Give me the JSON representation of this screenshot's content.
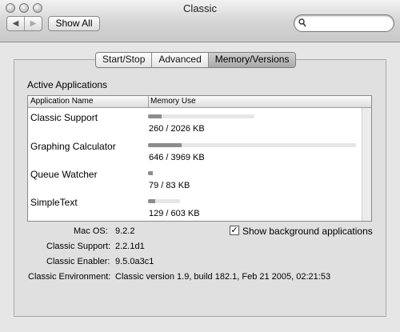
{
  "window": {
    "title": "Classic"
  },
  "toolbar": {
    "back_glyph": "◀",
    "forward_glyph": "▶",
    "show_all_label": "Show All",
    "search_value": ""
  },
  "tabs": [
    {
      "label": "Start/Stop",
      "selected": false
    },
    {
      "label": "Advanced",
      "selected": false
    },
    {
      "label": "Memory/Versions",
      "selected": true
    }
  ],
  "section": {
    "title": "Active Applications"
  },
  "table": {
    "columns": [
      "Application Name",
      "Memory Use"
    ],
    "rows": [
      {
        "name": "Classic Support",
        "memory_text": "260 / 2026 KB",
        "used_kb": 260,
        "total_kb": 2026
      },
      {
        "name": "Graphing Calculator",
        "memory_text": "646 / 3969 KB",
        "used_kb": 646,
        "total_kb": 3969
      },
      {
        "name": "Queue Watcher",
        "memory_text": "79 / 83 KB",
        "used_kb": 79,
        "total_kb": 83
      },
      {
        "name": "SimpleText",
        "memory_text": "129 / 603 KB",
        "used_kb": 129,
        "total_kb": 603
      }
    ]
  },
  "options": {
    "show_background_label": "Show background applications",
    "show_background_checked": true,
    "check_glyph": "✓"
  },
  "info": [
    {
      "label": "Mac OS:",
      "value": "9.2.2"
    },
    {
      "label": "Classic Support:",
      "value": "2.2.1d1"
    },
    {
      "label": "Classic Enabler:",
      "value": "9.5.0a3c1"
    },
    {
      "label": "Classic Environment:",
      "value": "Classic version 1.9, build 182.1, Feb 21 2005, 02:21:53"
    }
  ]
}
